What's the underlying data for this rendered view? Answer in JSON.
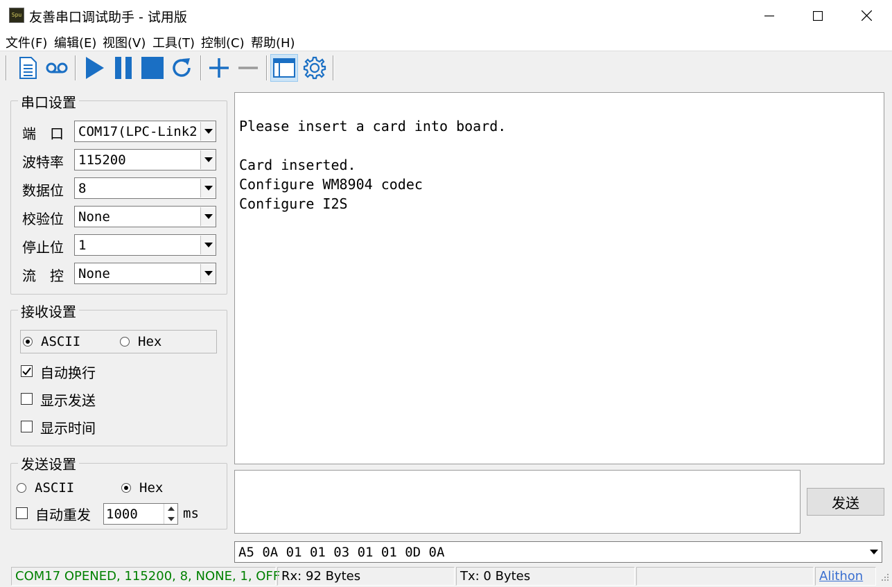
{
  "window": {
    "title": "友善串口调试助手 - 试用版",
    "icon_text": "Spu"
  },
  "menu": [
    "文件(F)",
    "编辑(E)",
    "视图(V)",
    "工具(T)",
    "控制(C)",
    "帮助(H)"
  ],
  "toolbar_icons": [
    "document-icon",
    "record-icon",
    "play-icon",
    "pause-icon",
    "stop-icon",
    "refresh-icon",
    "add-icon",
    "remove-icon",
    "window-icon",
    "settings-icon"
  ],
  "serial": {
    "legend": "串口设置",
    "port_label": "端　口",
    "port_value": "COM17(LPC-Link2",
    "baud_label": "波特率",
    "baud_value": "115200",
    "databits_label": "数据位",
    "databits_value": "8",
    "parity_label": "校验位",
    "parity_value": "None",
    "stopbits_label": "停止位",
    "stopbits_value": "1",
    "flow_label": "流　控",
    "flow_value": "None"
  },
  "receive": {
    "legend": "接收设置",
    "ascii_label": "ASCII",
    "hex_label": "Hex",
    "selected": "ASCII",
    "auto_wrap_label": "自动换行",
    "auto_wrap": true,
    "show_send_label": "显示发送",
    "show_send": false,
    "show_time_label": "显示时间",
    "show_time": false
  },
  "send": {
    "legend": "发送设置",
    "ascii_label": "ASCII",
    "hex_label": "Hex",
    "selected": "Hex",
    "auto_repeat_label": "自动重发",
    "auto_repeat": false,
    "interval_value": "1000",
    "interval_unit": "ms",
    "button_label": "发送",
    "input_value": ""
  },
  "receive_text": "Please insert a card into board.\n\nCard inserted.\nConfigure WM8904 codec\nConfigure I2S",
  "history_value": "A5 0A 01 01 03 01 01 0D 0A",
  "status": {
    "connection": "COM17 OPENED, 115200, 8, NONE, 1, OFF",
    "rx": "Rx: 92 Bytes",
    "tx": "Tx: 0 Bytes",
    "extra": "",
    "brand": "Alithon"
  },
  "colors": {
    "status_ok": "#008000",
    "accent": "#1a6fc4",
    "link": "#3a6fd0"
  }
}
